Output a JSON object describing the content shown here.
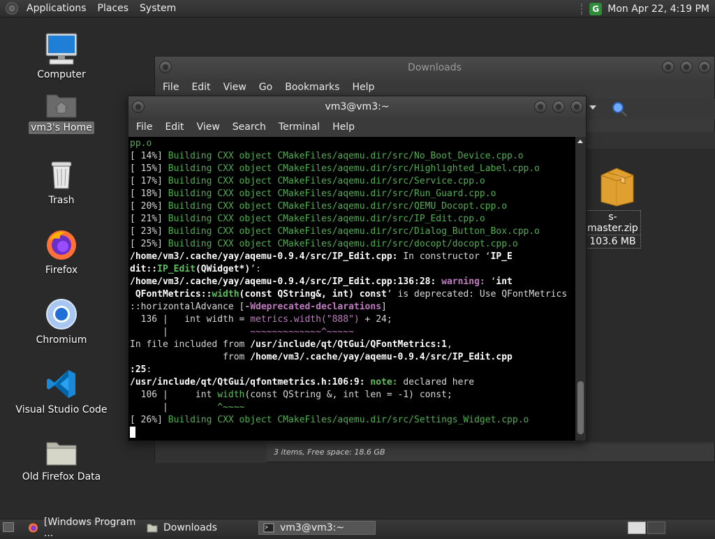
{
  "top_panel": {
    "menus": [
      "Applications",
      "Places",
      "System"
    ],
    "clock": "Mon Apr 22,  4:19 PM",
    "update_icon": "update-manager-icon",
    "update_glyph": "G"
  },
  "desktop": {
    "icons": [
      {
        "label": "Computer",
        "icon": "computer-icon"
      },
      {
        "label": "vm3's Home",
        "icon": "home-folder-icon"
      },
      {
        "label": "Trash",
        "icon": "trash-icon"
      },
      {
        "label": "Firefox",
        "icon": "firefox-icon"
      },
      {
        "label": "Chromium",
        "icon": "chromium-icon"
      },
      {
        "label": "Visual Studio Code",
        "icon": "vscode-icon"
      },
      {
        "label": "Old Firefox Data",
        "icon": "folder-icon"
      }
    ]
  },
  "file_manager": {
    "title": "Downloads",
    "menu": [
      "File",
      "Edit",
      "View",
      "Go",
      "Bookmarks",
      "Help"
    ],
    "item": {
      "name": "s-master.zip",
      "size": "103.6 MB",
      "icon": "package-icon"
    },
    "status": "3 items, Free space: 18.6 GB"
  },
  "terminal": {
    "title": "vm3@vm3:~",
    "menu": [
      "File",
      "Edit",
      "View",
      "Search",
      "Terminal",
      "Help"
    ],
    "lines": [
      [
        {
          "t": "pp.o",
          "c": "g"
        }
      ],
      [
        {
          "t": "[ 14%] ",
          "c": ""
        },
        {
          "t": "Building CXX object CMakeFiles/aqemu.dir/src/No_Boot_Device.cpp.o",
          "c": "g"
        }
      ],
      [
        {
          "t": "[ 15%] ",
          "c": ""
        },
        {
          "t": "Building CXX object CMakeFiles/aqemu.dir/src/Highlighted_Label.cpp.o",
          "c": "g"
        }
      ],
      [
        {
          "t": "[ 17%] ",
          "c": ""
        },
        {
          "t": "Building CXX object CMakeFiles/aqemu.dir/src/Service.cpp.o",
          "c": "g"
        }
      ],
      [
        {
          "t": "[ 18%] ",
          "c": ""
        },
        {
          "t": "Building CXX object CMakeFiles/aqemu.dir/src/Run_Guard.cpp.o",
          "c": "g"
        }
      ],
      [
        {
          "t": "[ 20%] ",
          "c": ""
        },
        {
          "t": "Building CXX object CMakeFiles/aqemu.dir/src/QEMU_Docopt.cpp.o",
          "c": "g"
        }
      ],
      [
        {
          "t": "[ 21%] ",
          "c": ""
        },
        {
          "t": "Building CXX object CMakeFiles/aqemu.dir/src/IP_Edit.cpp.o",
          "c": "g"
        }
      ],
      [
        {
          "t": "[ 23%] ",
          "c": ""
        },
        {
          "t": "Building CXX object CMakeFiles/aqemu.dir/src/Dialog_Button_Box.cpp.o",
          "c": "g"
        }
      ],
      [
        {
          "t": "[ 25%] ",
          "c": ""
        },
        {
          "t": "Building CXX object CMakeFiles/aqemu.dir/src/docopt/docopt.cpp.o",
          "c": "g"
        }
      ],
      [
        {
          "t": "/home/vm3/.cache/yay/aqemu-0.9.4/src/IP_Edit.cpp:",
          "c": "b"
        },
        {
          "t": " In constructor ‘",
          "c": ""
        },
        {
          "t": "IP_E",
          "c": "b"
        }
      ],
      [
        {
          "t": "dit::",
          "c": "b"
        },
        {
          "t": "IP_Edit",
          "c": "bg"
        },
        {
          "t": "(QWidget*)",
          "c": "b"
        },
        {
          "t": "’:",
          "c": ""
        }
      ],
      [
        {
          "t": "/home/vm3/.cache/yay/aqemu-0.9.4/src/IP_Edit.cpp:136:28:",
          "c": "b"
        },
        {
          "t": " ",
          "c": ""
        },
        {
          "t": "warning:",
          "c": "bm"
        },
        {
          "t": " ‘",
          "c": ""
        },
        {
          "t": "int",
          "c": "b"
        }
      ],
      [
        {
          "t": " QFontMetrics::",
          "c": "b"
        },
        {
          "t": "width",
          "c": "bg"
        },
        {
          "t": "(const QString&, int) const",
          "c": "b"
        },
        {
          "t": "’ is deprecated: Use QFontMetrics",
          "c": ""
        }
      ],
      [
        {
          "t": "::horizontalAdvance [",
          "c": ""
        },
        {
          "t": "-Wdeprecated-declarations",
          "c": "bm"
        },
        {
          "t": "]",
          "c": ""
        }
      ],
      [
        {
          "t": "  136 |   int width = ",
          "c": ""
        },
        {
          "t": "metrics.width(\"888\")",
          "c": "m"
        },
        {
          "t": " + 24;",
          "c": ""
        }
      ],
      [
        {
          "t": "      |               ",
          "c": ""
        },
        {
          "t": "~~~~~~~~~~~~~^~~~~~",
          "c": "m"
        }
      ],
      [
        {
          "t": "In file included from ",
          "c": ""
        },
        {
          "t": "/usr/include/qt/QtGui/QFontMetrics:1",
          "c": "b"
        },
        {
          "t": ",",
          "c": ""
        }
      ],
      [
        {
          "t": "                 from ",
          "c": ""
        },
        {
          "t": "/home/vm3/.cache/yay/aqemu-0.9.4/src/IP_Edit.cpp",
          "c": "b"
        }
      ],
      [
        {
          "t": ":25",
          "c": "b"
        },
        {
          "t": ":",
          "c": ""
        }
      ],
      [
        {
          "t": "/usr/include/qt/QtGui/qfontmetrics.h:106:9:",
          "c": "b"
        },
        {
          "t": " ",
          "c": ""
        },
        {
          "t": "note:",
          "c": "bg"
        },
        {
          "t": " declared here",
          "c": ""
        }
      ],
      [
        {
          "t": "  106 |     int ",
          "c": ""
        },
        {
          "t": "width",
          "c": "grn"
        },
        {
          "t": "(const QString &, int len = -1) const;",
          "c": ""
        }
      ],
      [
        {
          "t": "      |         ",
          "c": ""
        },
        {
          "t": "^~~~~",
          "c": "grn"
        }
      ],
      [
        {
          "t": "[ 26%] ",
          "c": ""
        },
        {
          "t": "Building CXX object CMakeFiles/aqemu.dir/src/Settings_Widget.cpp.o",
          "c": "g"
        }
      ]
    ]
  },
  "taskbar": {
    "tasks": [
      {
        "label": "[Windows Program ...",
        "icon": "firefox-icon",
        "active": false
      },
      {
        "label": "Downloads",
        "icon": "folder-icon",
        "active": false
      },
      {
        "label": "vm3@vm3:~",
        "icon": "terminal-icon",
        "active": true
      }
    ]
  }
}
